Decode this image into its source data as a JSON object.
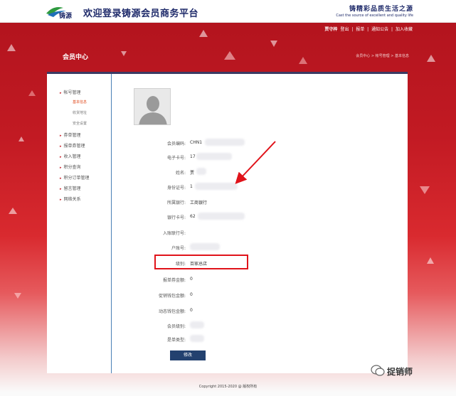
{
  "header": {
    "title": "欢迎登录铸源会员商务平台",
    "slogan_cn": "铸精彩品质生活之源",
    "slogan_en": "Cast the source of excellent and quality life",
    "logo_text": "铸源"
  },
  "toplinks": {
    "user": "贾守梓",
    "logout": "登出",
    "sep1": "|",
    "report": "报单",
    "sep2": "|",
    "notice": "通知公告",
    "sep3": "|",
    "favorite": "加入收藏"
  },
  "page": {
    "title": "会员中心",
    "breadcrumb": "会员中心 > 帐号管理 > 基本信息"
  },
  "sidebar": {
    "items": [
      {
        "label": "帐号管理"
      },
      {
        "label": "基本信息"
      },
      {
        "label": "收货地址"
      },
      {
        "label": "安全设置"
      },
      {
        "label": "券单管理"
      },
      {
        "label": "报单券管理"
      },
      {
        "label": "收入管理"
      },
      {
        "label": "积分查询"
      },
      {
        "label": "积分订单管理"
      },
      {
        "label": "留言管理"
      },
      {
        "label": "网络关系"
      }
    ]
  },
  "profile": {
    "member_no_label": "会员编码:",
    "member_no_value": "CHN1",
    "phone_label": "电子卡号:",
    "phone_value": "17",
    "name_label": "姓名:",
    "name_value": "贾",
    "idcard_label": "身份证号:",
    "idcard_value": "1",
    "bank_label": "所属银行:",
    "bank_value": "工商银行",
    "bankcard_label": "银行卡号:",
    "bankcard_value": "62",
    "branch_label": "入账联行号:",
    "branch_value": "",
    "account_label": "户账号:",
    "account_value": "",
    "level_label": "级别:",
    "level_value": "百家总店",
    "order_label": "报单券金额:",
    "order_value": "0",
    "promo_label": "促销钱包金额:",
    "promo_value": "0",
    "dynamic_label": "动态钱包金额:",
    "dynamic_value": "0",
    "mtype_label": "会员级别:",
    "mtype_value": "",
    "otype_label": "是单类型:",
    "otype_value": "",
    "edit_label": "修改"
  },
  "footer": {
    "copyright": "Copyright 2015-2020 @ 版权所有"
  },
  "watermark": {
    "text": "捉销师"
  },
  "colors": {
    "brand_red": "#c21a23",
    "nav_blue": "#23416f",
    "highlight_red": "#e0131a"
  }
}
